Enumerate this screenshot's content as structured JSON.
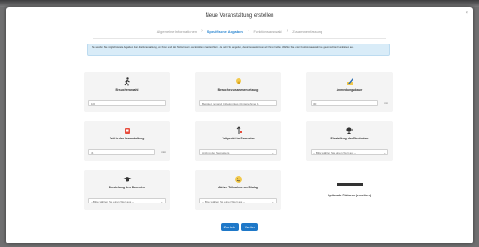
{
  "modal": {
    "title": "Neue Veranstaltung erstellen",
    "close_glyph": "×"
  },
  "steps": [
    {
      "label": "Allgemeine Informationen",
      "active": false
    },
    {
      "label": "Spezifische Angaben",
      "active": true
    },
    {
      "label": "Funktionsauswahl",
      "active": false
    },
    {
      "label": "Zusammenfassung",
      "active": false
    }
  ],
  "step_separator": "›",
  "info": {
    "text": "Sie werden Sie möglichst viele Angaben über die Veranstaltung, um Ihnen und den Teilnehmern das Erstellen zu erleichtern. Je mehr Sie angeben, desto besser können wir Ihnen helfen. Wählen Sie unter Funktionsauswahl die gewünschten Funktionen aus."
  },
  "cards": [
    {
      "label": "Besucheranzahl",
      "icon": "walking-person-icon",
      "control": "input",
      "value": "100",
      "unit": ""
    },
    {
      "label": "Besucherzusammensetzung",
      "icon": "people-icon",
      "control": "input",
      "value": "Beispiel, jemand Unbekanntes / Unternehmen 1",
      "unit": ""
    },
    {
      "label": "Anmeldungsdauer",
      "icon": "pencil-icon",
      "control": "input",
      "value": "30",
      "unit": "min"
    },
    {
      "label": "Zeit in der Veranstaltung",
      "icon": "timer-icon",
      "control": "input",
      "value": "45",
      "unit": "min"
    },
    {
      "label": "Zeitpunkt im Semester",
      "icon": "calendar-icon",
      "control": "select",
      "value": "Anfang des Semesters",
      "unit": ""
    },
    {
      "label": "Einstellung der Studenten",
      "icon": "person-head-icon",
      "control": "select",
      "value": "-- Bitte wählen Sie einen Wert aus --",
      "unit": ""
    },
    {
      "label": "Einstellung des Dozenten",
      "icon": "graduation-cap-icon",
      "control": "select",
      "value": "-- Bitte wählen Sie einen Wert aus --",
      "unit": ""
    },
    {
      "label": "Aktive Teilnahme am Dialog",
      "icon": "smiley-icon",
      "control": "select",
      "value": "-- Bitte wählen Sie einen Wert aus --",
      "unit": ""
    },
    {
      "label": "Optionale Faktoren (erweitern)",
      "icon": "minus-icon",
      "control": "none",
      "value": "",
      "unit": ""
    }
  ],
  "buttons": {
    "back": "Zurück",
    "next": "Weiter"
  },
  "colors": {
    "accent": "#1e78c8",
    "info_bg": "#d9ecf8"
  }
}
